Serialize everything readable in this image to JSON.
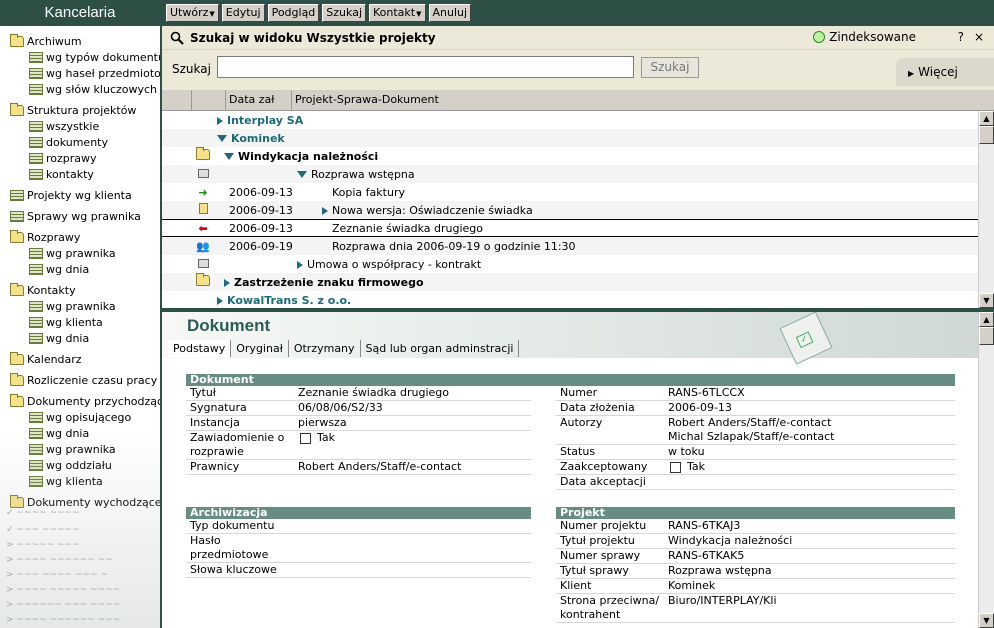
{
  "sidebar": {
    "title": "Kancelaria",
    "items": [
      {
        "label": "Archiwum",
        "icon": "folder-open-icon",
        "level": 0
      },
      {
        "label": "wg typów dokumentu",
        "icon": "list-icon",
        "level": 1
      },
      {
        "label": "wg haseł przedmiotow.",
        "icon": "list-icon",
        "level": 1
      },
      {
        "label": "wg słów kluczowych",
        "icon": "list-icon",
        "level": 1
      },
      {
        "label": "Struktura projektów",
        "icon": "folder-open-icon",
        "level": 0
      },
      {
        "label": "wszystkie",
        "icon": "list-icon",
        "level": 1
      },
      {
        "label": "dokumenty",
        "icon": "list-icon",
        "level": 1
      },
      {
        "label": "rozprawy",
        "icon": "list-icon",
        "level": 1
      },
      {
        "label": "kontakty",
        "icon": "list-icon",
        "level": 1
      },
      {
        "label": "Projekty wg klienta",
        "icon": "list-icon",
        "level": 0
      },
      {
        "label": "Sprawy wg prawnika",
        "icon": "list-icon",
        "level": 0
      },
      {
        "label": "Rozprawy",
        "icon": "folder-open-icon",
        "level": 0
      },
      {
        "label": "wg prawnika",
        "icon": "list-icon",
        "level": 1
      },
      {
        "label": "wg dnia",
        "icon": "list-icon",
        "level": 1
      },
      {
        "label": "Kontakty",
        "icon": "folder-open-icon",
        "level": 0
      },
      {
        "label": "wg prawnika",
        "icon": "list-icon",
        "level": 1
      },
      {
        "label": "wg klienta",
        "icon": "list-icon",
        "level": 1
      },
      {
        "label": "wg dnia",
        "icon": "list-icon",
        "level": 1
      },
      {
        "label": "Kalendarz",
        "icon": "folder-icon",
        "level": 0
      },
      {
        "label": "Rozliczenie czasu pracy",
        "icon": "folder-icon",
        "level": 0
      },
      {
        "label": "Dokumenty przychodzące",
        "icon": "folder-open-icon",
        "level": 0
      },
      {
        "label": "wg opisującego",
        "icon": "list-icon",
        "level": 1
      },
      {
        "label": "wg dnia",
        "icon": "list-icon",
        "level": 1
      },
      {
        "label": "wg prawnika",
        "icon": "list-icon",
        "level": 1
      },
      {
        "label": "wg oddziału",
        "icon": "list-icon",
        "level": 1
      },
      {
        "label": "wg klienta",
        "icon": "list-icon",
        "level": 1
      },
      {
        "label": "Dokumenty wychodzące",
        "icon": "folder-icon",
        "level": 0
      }
    ]
  },
  "toolbar": {
    "buttons": [
      {
        "label": "Utwórz",
        "has_menu": true
      },
      {
        "label": "Edytuj",
        "has_menu": false
      },
      {
        "label": "Podgląd",
        "has_menu": false
      },
      {
        "label": "Szukaj",
        "has_menu": false
      },
      {
        "label": "Kontakt",
        "has_menu": true
      },
      {
        "label": "Anuluj",
        "has_menu": false
      }
    ]
  },
  "search": {
    "title": "Szukaj w widoku Wszystkie projekty",
    "status": "Zindeksowane",
    "help": "?",
    "close": "×",
    "label": "Szukaj",
    "value": "",
    "button": "Szukaj",
    "more": "Więcej"
  },
  "grid": {
    "columns": [
      "Data zał",
      "Projekt-Sprawa-Dokument"
    ],
    "rows": [
      {
        "icon": "",
        "date": "",
        "text": "Interplay SA",
        "toggle": "collapsed",
        "style": "teal",
        "indent": 0
      },
      {
        "icon": "",
        "date": "",
        "text": "Kominek",
        "toggle": "expanded",
        "style": "teal",
        "indent": 0
      },
      {
        "icon": "folder-icon",
        "date": "",
        "text": "Windykacja należności",
        "toggle": "expanded",
        "style": "bold",
        "indent": 1
      },
      {
        "icon": "book-icon",
        "date": "",
        "text": "Rozprawa wstępna",
        "toggle": "expanded",
        "style": "normal",
        "indent": 2
      },
      {
        "icon": "arrow-right-icon",
        "date": "2006-09-13",
        "text": "Kopia faktury",
        "toggle": "",
        "style": "normal",
        "indent": 3
      },
      {
        "icon": "document-icon",
        "date": "2006-09-13",
        "text": "Nowa wersja: Oświadczenie świadka",
        "toggle": "collapsed",
        "style": "normal",
        "indent": 3
      },
      {
        "icon": "arrow-left-icon",
        "date": "2006-09-13",
        "text": "Zeznanie świadka drugiego",
        "toggle": "",
        "style": "normal",
        "indent": 3
      },
      {
        "icon": "people-icon",
        "date": "2006-09-19",
        "text": "Rozprawa dnia 2006-09-19 o godzinie 11:30",
        "toggle": "",
        "style": "normal",
        "indent": 3
      },
      {
        "icon": "book-icon",
        "date": "",
        "text": "Umowa o współpracy - kontrakt",
        "toggle": "collapsed",
        "style": "normal",
        "indent": 2
      },
      {
        "icon": "folder-icon",
        "date": "",
        "text": "Zastrzeżenie znaku firmowego",
        "toggle": "collapsed",
        "style": "bold",
        "indent": 1
      },
      {
        "icon": "",
        "date": "",
        "text": "KowalTrans S. z o.o.",
        "toggle": "collapsed",
        "style": "teal",
        "indent": 0
      }
    ]
  },
  "doc": {
    "title": "Dokument",
    "tabs": [
      "Podstawy",
      "Oryginał",
      "Otrzymany",
      "Sąd lub organ adminstracji"
    ],
    "dokument_section": {
      "title": "Dokument",
      "left": [
        {
          "label": "Tytuł",
          "value": "Zeznanie świadka drugiego"
        },
        {
          "label": "Sygnatura",
          "value": "06/08/06/S2/33"
        },
        {
          "label": "Instancja",
          "value": "pierwsza"
        },
        {
          "label": "Zawiadomienie o rozprawie",
          "value": "Tak",
          "checkbox": true
        },
        {
          "label": "Prawnicy",
          "value": "Robert Anders/Staff/e-contact"
        }
      ],
      "right": [
        {
          "label": "Numer",
          "value": "RANS-6TLCCX"
        },
        {
          "label": "Data złożenia",
          "value": "2006-09-13"
        },
        {
          "label": "Autorzy",
          "value": "Robert Anders/Staff/e-contact\nMichal Szlapak/Staff/e-contact"
        },
        {
          "label": "Status",
          "value": "w toku"
        },
        {
          "label": "Zaakceptowany",
          "value": "Tak",
          "checkbox": true
        },
        {
          "label": "Data akceptacji",
          "value": ""
        }
      ]
    },
    "archiwizacja": {
      "title": "Archiwizacja",
      "rows": [
        {
          "label": "Typ dokumentu",
          "value": ""
        },
        {
          "label": "Hasło przedmiotowe",
          "value": ""
        },
        {
          "label": "Słowa kluczowe",
          "value": ""
        }
      ]
    },
    "projekt": {
      "title": "Projekt",
      "rows": [
        {
          "label": "Numer projektu",
          "value": "RANS-6TKAJ3"
        },
        {
          "label": "Tytuł projektu",
          "value": "Windykacja należności"
        },
        {
          "label": "Numer sprawy",
          "value": "RANS-6TKAK5"
        },
        {
          "label": "Tytuł sprawy",
          "value": "Rozprawa wstępna"
        },
        {
          "label": "Klient",
          "value": "Kominek"
        },
        {
          "label": "Strona przeciwna/ kontrahent",
          "value": "Biuro/INTERPLAY/Kli"
        }
      ]
    }
  }
}
